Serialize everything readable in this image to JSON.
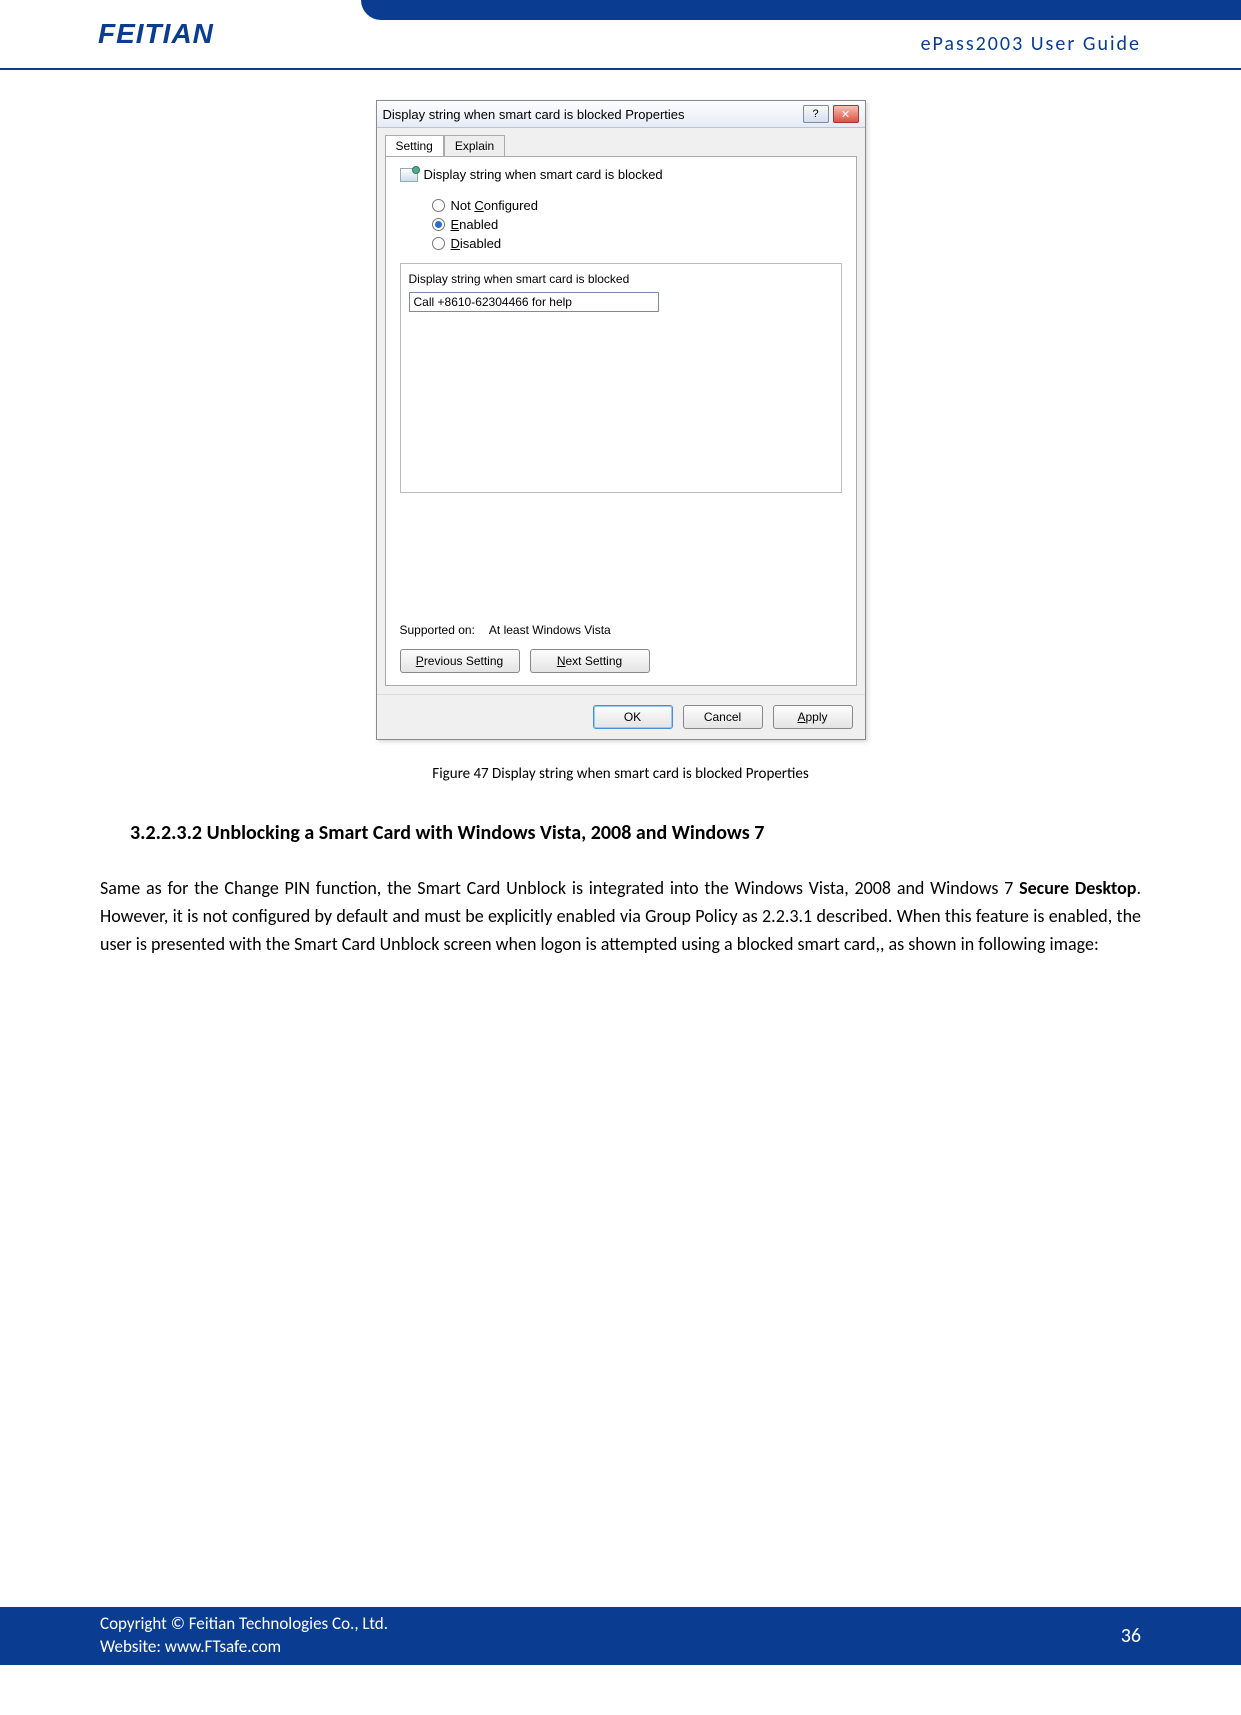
{
  "header": {
    "logo": "FEITIAN",
    "doc_title": "ePass2003  User  Guide"
  },
  "dialog": {
    "title": "Display string when smart card is blocked Properties",
    "help_glyph": "?",
    "close_glyph": "✕",
    "tabs": {
      "active": "Setting",
      "inactive": "Explain"
    },
    "policy_name": "Display string when smart card is blocked",
    "radios": {
      "not_configured_pre": "Not ",
      "not_configured_u": "C",
      "not_configured_post": "onfigured",
      "enabled_u": "E",
      "enabled_post": "nabled",
      "disabled_u": "D",
      "disabled_post": "isabled"
    },
    "inner_label": "Display string when smart card is blocked",
    "inner_value": "Call +8610-62304466 for help",
    "supported_label": "Supported on:",
    "supported_value": "At least Windows Vista",
    "prev_pre": "",
    "prev_u": "P",
    "prev_post": "revious Setting",
    "next_pre": "",
    "next_u": "N",
    "next_post": "ext Setting",
    "ok": "OK",
    "cancel": "Cancel",
    "apply_u": "A",
    "apply_post": "pply"
  },
  "caption": "Figure 47 Display string when smart card is blocked Properties",
  "section_heading": "3.2.2.3.2 Unblocking a Smart Card with Windows Vista, 2008 and Windows 7",
  "body": {
    "p1a": "Same as for the Change PIN function, the Smart Card Unblock is integrated into the Windows Vista, 2008 and Windows 7 ",
    "p1b": "Secure Desktop",
    "p1c": ". However, it is not configured by default and must be explicitly enabled via Group Policy as 2.2.3.1 described. When this feature is enabled, the user is presented with the Smart Card Unblock screen when logon is attempted using a blocked smart card,, as shown in following image:"
  },
  "footer": {
    "copyright": "Copyright © Feitian Technologies Co., Ltd.",
    "website": "Website: www.FTsafe.com",
    "page": "36"
  }
}
